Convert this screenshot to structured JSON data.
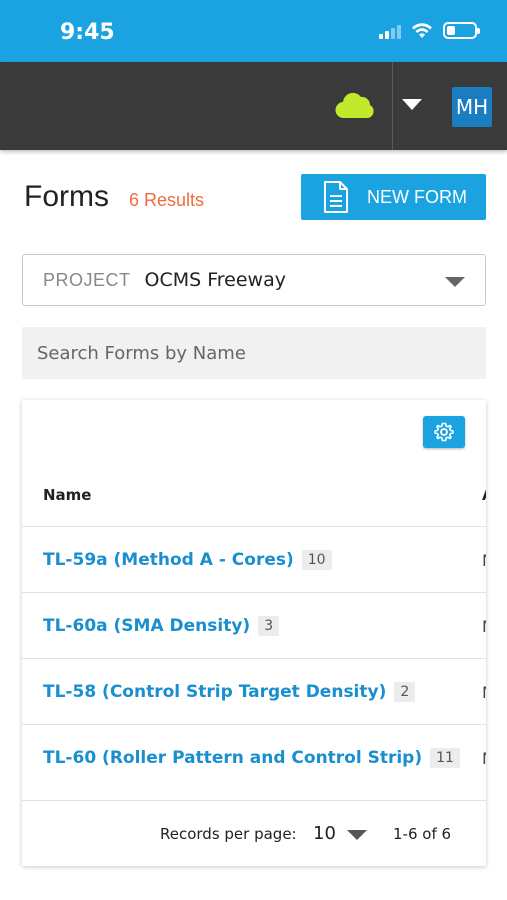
{
  "status_bar": {
    "time": "9:45",
    "battery_level": 0.3,
    "icons": [
      "signal-icon",
      "wifi-icon",
      "battery-icon"
    ]
  },
  "header": {
    "cloud_icon": "cloud-icon",
    "cloud_color": "#c3e92d",
    "user_initials": "MH"
  },
  "page": {
    "title": "Forms",
    "result_count": "6 Results",
    "new_form_label": "NEW FORM"
  },
  "project_select": {
    "label": "PROJECT",
    "value": "OCMS Freeway"
  },
  "search": {
    "placeholder": "Search Forms by Name",
    "value": ""
  },
  "table": {
    "columns": [
      "Name",
      "A"
    ],
    "rows": [
      {
        "name": "TL-59a (Method A - Cores)",
        "count": "10",
        "col2": "M"
      },
      {
        "name": "TL-60a (SMA Density)",
        "count": "3",
        "col2": "M"
      },
      {
        "name": "TL-58 (Control Strip Target Density)",
        "count": "2",
        "col2": "M"
      },
      {
        "name": "TL-60 (Roller Pattern and Control Strip)",
        "count": "11",
        "col2": "M"
      }
    ],
    "footer": {
      "records_label": "Records per page:",
      "records_value": "10",
      "range": "1-6 of 6"
    }
  },
  "colors": {
    "accent": "#1aa3e0",
    "header_bg": "#3a3a3a",
    "result_count": "#f26a3d",
    "link": "#1a8fd0"
  }
}
